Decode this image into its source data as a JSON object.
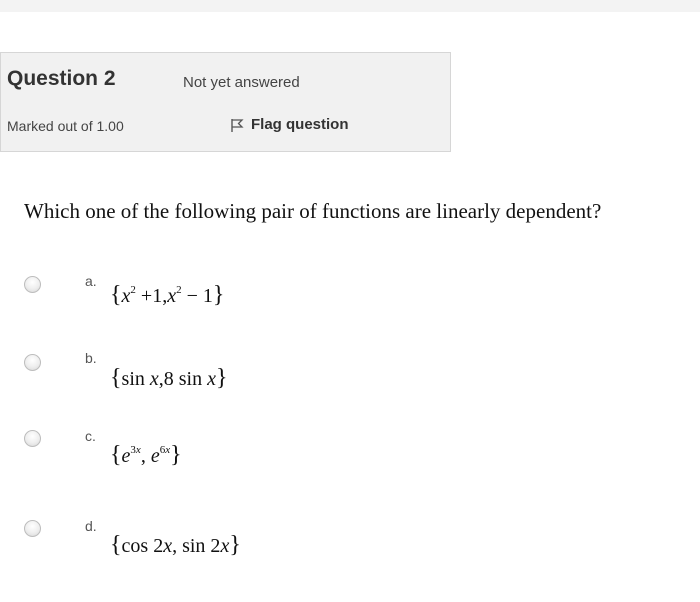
{
  "info": {
    "question_label": "Question 2",
    "state": "Not yet answered",
    "grade": "Marked out of 1.00",
    "flag_label": "Flag question"
  },
  "question": {
    "text": "Which one of the following pair of functions are linearly dependent?"
  },
  "options": [
    {
      "letter": "a.",
      "parts": {
        "open": "{",
        "f1_base": "x",
        "f1_exp": "2",
        "f1_rest": " +1,",
        "f2_base": "x",
        "f2_exp": "2",
        "f2_rest": " − 1",
        "close": "}"
      }
    },
    {
      "letter": "b.",
      "parts": {
        "open": "{",
        "f1_fn": "sin ",
        "f1_var": "x",
        "sep": ",",
        "f2_fn": "8 sin ",
        "f2_var": "x",
        "close": "}"
      }
    },
    {
      "letter": "c.",
      "parts": {
        "open": "{",
        "f1_base": "e",
        "f1_exp_num": "3",
        "f1_exp_var": "x",
        "sep": ", ",
        "f2_base": "e",
        "f2_exp_num": "6",
        "f2_exp_var": "x",
        "close": "}"
      }
    },
    {
      "letter": "d.",
      "parts": {
        "open": "{",
        "f1_fn": "cos 2",
        "f1_var": "x",
        "sep": ", ",
        "f2_fn": "sin 2",
        "f2_var": "x",
        "close": "}"
      }
    }
  ],
  "icons": {
    "flag": "flag-icon",
    "radio": "radio-button"
  }
}
